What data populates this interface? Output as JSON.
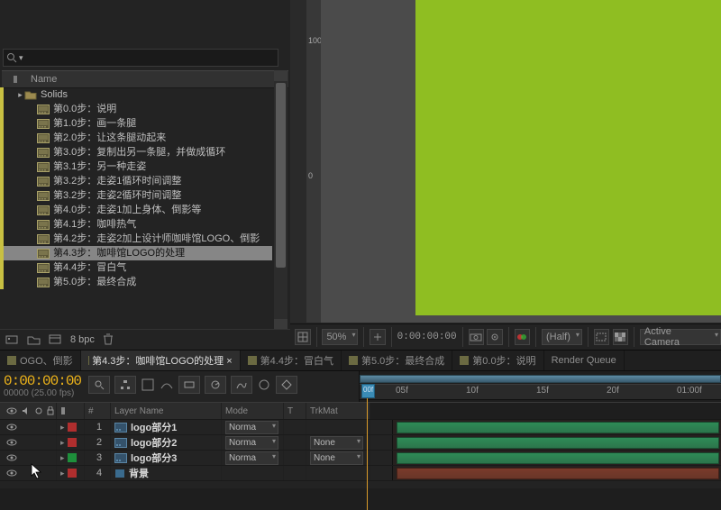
{
  "project": {
    "search_placeholder": "",
    "header": "Name",
    "items": [
      {
        "label": "Solids",
        "icon": "folder",
        "indent": 1,
        "color": "#c8c042"
      },
      {
        "label": "第0.0步：说明",
        "icon": "comp",
        "indent": 2,
        "color": "#c8c042"
      },
      {
        "label": "第1.0步：画一条腿",
        "icon": "comp",
        "indent": 2,
        "color": "#c8c042"
      },
      {
        "label": "第2.0步：让这条腿动起来",
        "icon": "comp",
        "indent": 2,
        "color": "#c8c042"
      },
      {
        "label": "第3.0步：复制出另一条腿，并做成循环",
        "icon": "comp",
        "indent": 2,
        "color": "#c8c042"
      },
      {
        "label": "第3.1步：另一种走姿",
        "icon": "comp",
        "indent": 2,
        "color": "#c8c042"
      },
      {
        "label": "第3.2步：走姿1循环时间调整",
        "icon": "comp",
        "indent": 2,
        "color": "#c8c042"
      },
      {
        "label": "第3.2步：走姿2循环时间调整",
        "icon": "comp",
        "indent": 2,
        "color": "#c8c042"
      },
      {
        "label": "第4.0步：走姿1加上身体、倒影等",
        "icon": "comp",
        "indent": 2,
        "color": "#c8c042"
      },
      {
        "label": "第4.1步：咖啡热气",
        "icon": "comp",
        "indent": 2,
        "color": "#c8c042"
      },
      {
        "label": "第4.2步：走姿2加上设计师咖啡馆LOGO、倒影",
        "icon": "comp",
        "indent": 2,
        "color": "#c8c042"
      },
      {
        "label": "第4.3步：咖啡馆LOGO的处理",
        "icon": "comp",
        "indent": 2,
        "color": "#c8c042",
        "selected": true
      },
      {
        "label": "第4.4步：冒白气",
        "icon": "comp",
        "indent": 2,
        "color": "#c8c042"
      },
      {
        "label": "第5.0步：最终合成",
        "icon": "comp",
        "indent": 2,
        "color": "#c8c042"
      }
    ],
    "footer_bpc": "8 bpc"
  },
  "viewer": {
    "zoom": "50%",
    "timecode": "0:00:00:00",
    "res": "(Half)",
    "camera": "Active Camera",
    "ruler_vals": [
      "0",
      "100"
    ]
  },
  "timeline": {
    "tabs": [
      {
        "label": "OGO、倒影"
      },
      {
        "label": "第4.3步：咖啡馆LOGO的处理 ×",
        "active": true
      },
      {
        "label": "第4.4步：冒白气"
      },
      {
        "label": "第5.0步：最终合成"
      },
      {
        "label": "第0.0步：说明"
      },
      {
        "label": "Render Queue",
        "render": true
      }
    ],
    "timecode": "0:00:00:00",
    "fps": "00000 (25.00 fps)",
    "playhead_label": "00f",
    "ruler": [
      "05f",
      "10f",
      "15f",
      "20f",
      "01:00f"
    ],
    "columns": {
      "num": "#",
      "layer": "Layer Name",
      "mode": "Mode",
      "t": "T",
      "trkmat": "TrkMat"
    },
    "layers": [
      {
        "num": "1",
        "name": "logo部分1",
        "mode": "Norma",
        "trkmat": "",
        "color": "#b02e2e",
        "track": "#2e8b57"
      },
      {
        "num": "2",
        "name": "logo部分2",
        "mode": "Norma",
        "trkmat": "None",
        "color": "#b02e2e",
        "track": "#2e8b57"
      },
      {
        "num": "3",
        "name": "logo部分3",
        "mode": "Norma",
        "trkmat": "None",
        "color": "#1e8f3b",
        "track": "#2e8b57"
      },
      {
        "num": "4",
        "name": "背景",
        "mode": "",
        "trkmat": "",
        "color": "#b02e2e",
        "track": "#7a3b2b",
        "solid": true
      }
    ]
  }
}
